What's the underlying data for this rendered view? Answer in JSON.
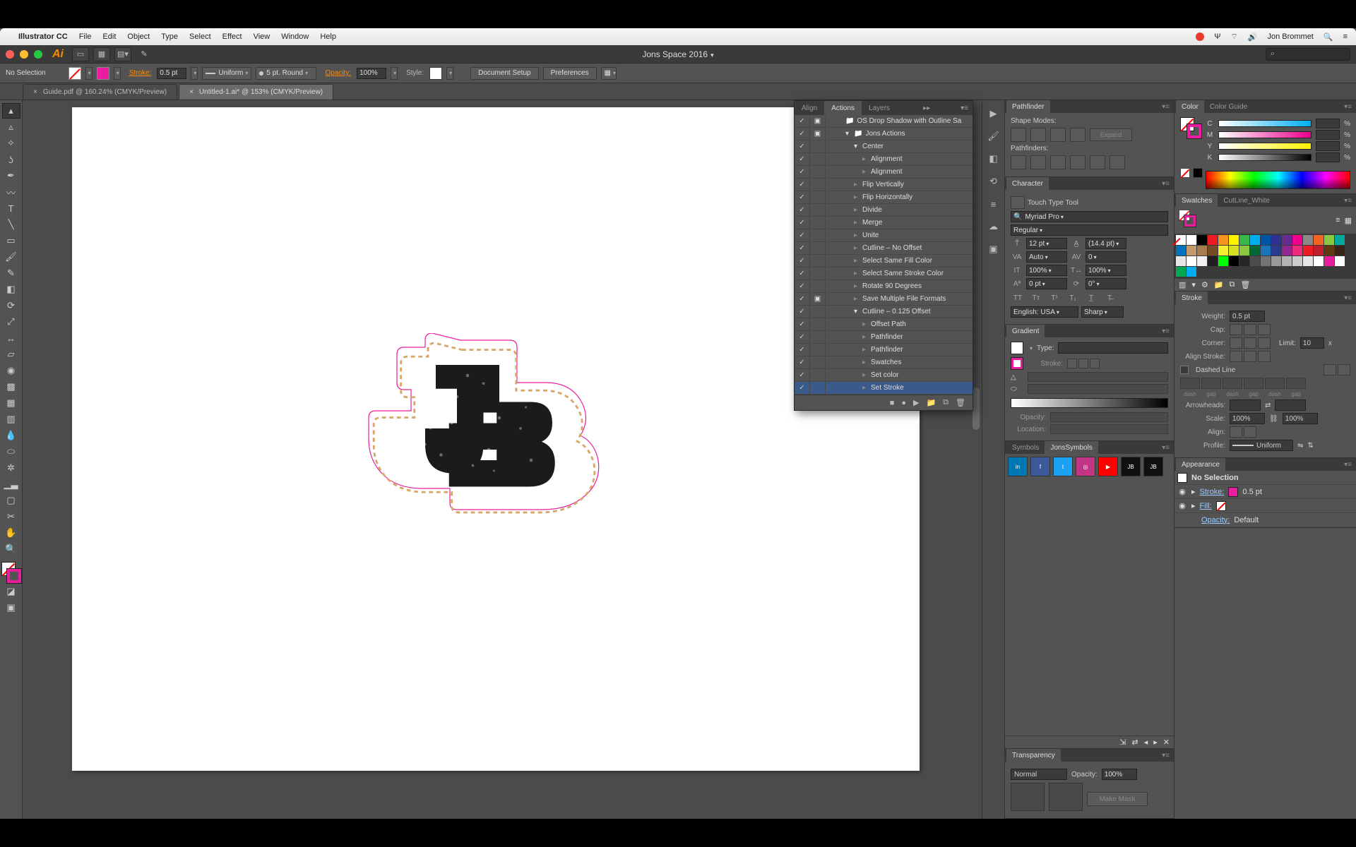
{
  "menubar": {
    "app": "Illustrator CC",
    "items": [
      "File",
      "Edit",
      "Object",
      "Type",
      "Select",
      "Effect",
      "View",
      "Window",
      "Help"
    ],
    "user": "Jon Brommet"
  },
  "titlebar": {
    "workspace": "Jons Space 2016"
  },
  "controlbar": {
    "selection": "No Selection",
    "stroke_label": "Stroke:",
    "stroke_weight": "0.5 pt",
    "brush": "Uniform",
    "profile": "5 pt. Round",
    "opacity_label": "Opacity:",
    "opacity": "100%",
    "style_label": "Style:",
    "doc_setup": "Document Setup",
    "prefs": "Preferences"
  },
  "doctabs": {
    "a": "Guide.pdf @ 160.24% (CMYK/Preview)",
    "b": "Untitled-1.ai* @ 153% (CMYK/Preview)"
  },
  "actions": {
    "tabs": [
      "Align",
      "Actions",
      "Layers"
    ],
    "items": [
      {
        "indent": 2,
        "folder": true,
        "label": "OS Drop Shadow with Outline Sa",
        "chk2": "▣"
      },
      {
        "indent": 2,
        "folder": true,
        "label": "Jons Actions",
        "chk2": "▣",
        "open": true
      },
      {
        "indent": 3,
        "label": "Center",
        "open": true
      },
      {
        "indent": 4,
        "label": "Alignment"
      },
      {
        "indent": 4,
        "label": "Alignment"
      },
      {
        "indent": 3,
        "label": "Flip Vertically"
      },
      {
        "indent": 3,
        "label": "Flip Horizontally"
      },
      {
        "indent": 3,
        "label": "Divide"
      },
      {
        "indent": 3,
        "label": "Merge"
      },
      {
        "indent": 3,
        "label": "Unite"
      },
      {
        "indent": 3,
        "label": "Cutline – No Offset"
      },
      {
        "indent": 3,
        "label": "Select Same Fill Color"
      },
      {
        "indent": 3,
        "label": "Select Same Stroke Color"
      },
      {
        "indent": 3,
        "label": "Rotate 90 Degrees"
      },
      {
        "indent": 3,
        "label": "Save Multiple File Formats",
        "chk2": "▣"
      },
      {
        "indent": 3,
        "label": "Cutline – 0.125 Offset",
        "open": true
      },
      {
        "indent": 4,
        "label": "Offset Path"
      },
      {
        "indent": 4,
        "label": "Pathfinder"
      },
      {
        "indent": 4,
        "label": "Pathfinder"
      },
      {
        "indent": 4,
        "label": "Swatches"
      },
      {
        "indent": 4,
        "label": "Set color"
      },
      {
        "indent": 4,
        "label": "Set Stroke",
        "hl": true
      }
    ]
  },
  "pathfinder": {
    "title": "Pathfinder",
    "shape_modes": "Shape Modes:",
    "expand": "Expand",
    "pathfinders": "Pathfinders:"
  },
  "character": {
    "title": "Character",
    "touch": "Touch Type Tool",
    "font": "Myriad Pro",
    "style": "Regular",
    "size": "12 pt",
    "leading": "(14.4 pt)",
    "kerning": "Auto",
    "tracking": "0",
    "vscale": "100%",
    "hscale": "100%",
    "baseline": "0 pt",
    "rotation": "0°",
    "lang": "English: USA",
    "aa": "Sharp"
  },
  "gradient": {
    "title": "Gradient",
    "type_label": "Type:",
    "stroke_label": "Stroke:",
    "opacity_label": "Opacity:",
    "location_label": "Location:"
  },
  "symbols": {
    "tabs": [
      "Symbols",
      "JonsSymbols"
    ]
  },
  "transparency": {
    "title": "Transparency",
    "mode": "Normal",
    "opacity_label": "Opacity:",
    "opacity": "100%",
    "make_mask": "Make Mask"
  },
  "color": {
    "tabs": [
      "Color",
      "Color Guide"
    ],
    "labels": {
      "c": "C",
      "m": "M",
      "y": "Y",
      "k": "K"
    },
    "pct": "%"
  },
  "swatches": {
    "tabs": [
      "Swatches",
      "CutLine_White"
    ]
  },
  "stroke": {
    "title": "Stroke",
    "weight_l": "Weight:",
    "weight": "0.5 pt",
    "cap_l": "Cap:",
    "corner_l": "Corner:",
    "limit_l": "Limit:",
    "limit": "10",
    "limit_x": "x",
    "align_l": "Align Stroke:",
    "dashed": "Dashed Line",
    "dash": "dash",
    "gap": "gap",
    "arrows_l": "Arrowheads:",
    "scale_l": "Scale:",
    "scale": "100%",
    "align2_l": "Align:",
    "profile_l": "Profile:",
    "profile": "Uniform"
  },
  "appearance": {
    "title": "Appearance",
    "nosel": "No Selection",
    "stroke_l": "Stroke:",
    "stroke_w": "0.5 pt",
    "fill_l": "Fill:",
    "opacity_l": "Opacity:",
    "opacity_v": "Default"
  }
}
